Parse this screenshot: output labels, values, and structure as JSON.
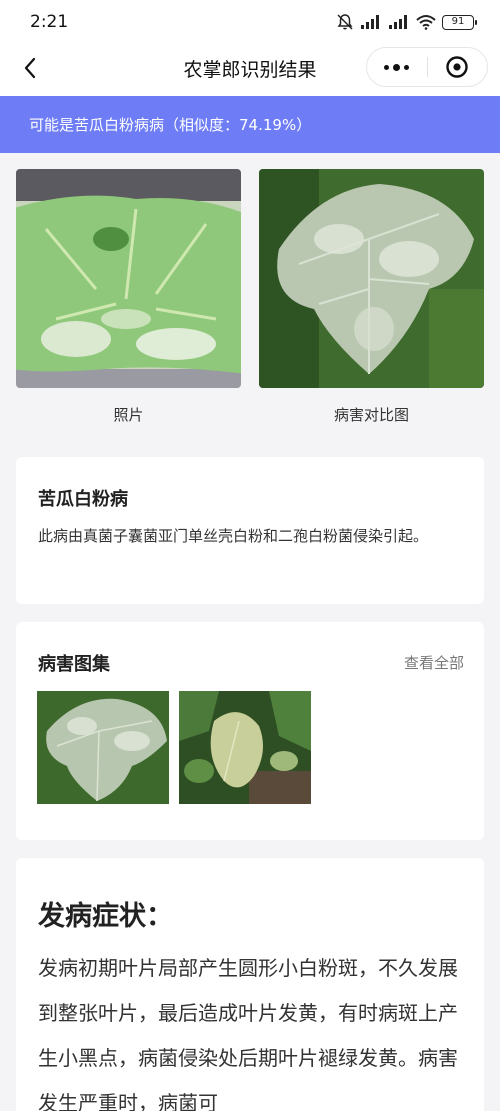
{
  "status_bar": {
    "time": "2:21",
    "battery": "91"
  },
  "nav": {
    "title": "农掌郎识别结果"
  },
  "banner": {
    "text": "可能是苦瓜白粉病病（相似度：74.19%）"
  },
  "photos": {
    "left_caption": "照片",
    "right_caption": "病害对比图"
  },
  "info": {
    "title": "苦瓜白粉病",
    "description": "此病由真菌子囊菌亚门单丝壳白粉和二孢白粉菌侵染引起。"
  },
  "gallery": {
    "title": "病害图集",
    "view_all": "查看全部"
  },
  "symptom": {
    "title": "发病症状：",
    "body": "发病初期叶片局部产生圆形小白粉斑，不久发展到整张叶片，最后造成叶片发黄，有时病斑上产生小黑点，病菌侵染处后期叶片褪绿发黄。病害发生严重时，病菌可"
  },
  "colors": {
    "accent": "#6e7df5",
    "background": "#f4f4f6"
  }
}
